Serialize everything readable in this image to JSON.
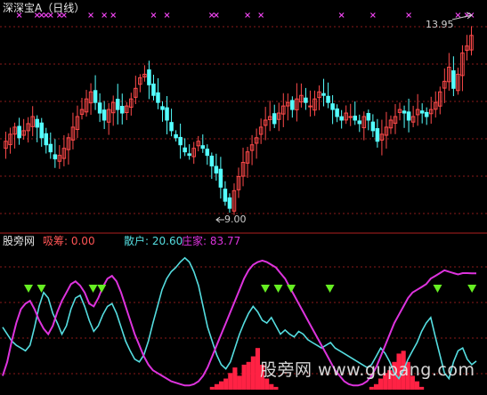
{
  "header": {
    "title": "深深宝A（日线）"
  },
  "indicator_header": {
    "name": "股旁网",
    "absorb": "吸筹: 0.00",
    "retail": "散户: 20.60",
    "dealer": "庄家: 83.77"
  },
  "annotations": {
    "high_price": "13.95",
    "low_price": "9.00"
  },
  "watermark": "股旁网 www.gupang.com",
  "colors": {
    "background": "#000000",
    "up_candle": "#ff4a4a",
    "down_candle": "#54ffff",
    "retail_line": "#55dde0",
    "dealer_line": "#dd33dd",
    "absorb_bars": "#ff2244",
    "signal_marker": "#66ee22",
    "top_markers": "#ee44ee",
    "grid": "#8a1a1a"
  },
  "chart_data": [
    {
      "type": "candlestick",
      "title": "深深宝A（日线）",
      "price_high": 13.95,
      "price_low": 9.0,
      "ylim": [
        8.6,
        14.5
      ],
      "close_series": [
        10.9,
        11.1,
        11.3,
        11.0,
        11.2,
        11.4,
        11.6,
        11.3,
        11.0,
        10.8,
        10.6,
        10.4,
        10.5,
        10.7,
        11.0,
        11.3,
        11.6,
        11.8,
        12.1,
        12.3,
        12.0,
        11.7,
        11.5,
        11.8,
        12.0,
        11.8,
        11.7,
        11.9,
        12.1,
        12.4,
        12.7,
        12.8,
        12.5,
        12.2,
        12.0,
        11.8,
        11.5,
        11.2,
        11.0,
        10.8,
        10.6,
        10.5,
        10.7,
        10.9,
        10.7,
        10.5,
        10.2,
        10.0,
        9.6,
        9.2,
        9.0,
        9.5,
        9.9,
        10.3,
        10.6,
        10.8,
        11.0,
        11.3,
        11.5,
        11.6,
        11.4,
        11.7,
        11.9,
        12.0,
        11.8,
        12.1,
        12.2,
        12.0,
        11.9,
        12.1,
        12.3,
        12.2,
        12.0,
        11.8,
        11.6,
        11.5,
        11.7,
        11.6,
        11.5,
        11.4,
        11.6,
        11.5,
        11.2,
        10.9,
        11.1,
        11.3,
        11.5,
        11.6,
        11.8,
        11.7,
        11.5,
        11.6,
        11.8,
        11.7,
        11.6,
        11.8,
        12.0,
        12.3,
        12.6,
        13.0,
        12.4,
        12.8,
        13.4,
        13.6,
        13.9
      ],
      "marker_type": "cross",
      "x_markers": [
        3,
        7,
        8,
        9,
        10,
        12,
        13,
        19,
        22,
        24,
        33,
        36,
        46,
        47,
        54,
        57,
        75,
        82,
        90,
        101,
        103,
        104
      ]
    },
    {
      "type": "line",
      "title": "股旁网",
      "ylim": [
        0,
        100
      ],
      "series": [
        {
          "name": "散户",
          "current": 20.6,
          "values": [
            45,
            40,
            35,
            32,
            30,
            28,
            32,
            45,
            60,
            70,
            66,
            55,
            48,
            40,
            46,
            58,
            66,
            68,
            60,
            50,
            42,
            46,
            54,
            60,
            62,
            55,
            45,
            35,
            28,
            22,
            20,
            25,
            35,
            48,
            60,
            72,
            80,
            85,
            88,
            92,
            95,
            92,
            85,
            75,
            60,
            45,
            35,
            25,
            18,
            15,
            20,
            30,
            40,
            48,
            55,
            60,
            56,
            50,
            48,
            52,
            46,
            40,
            43,
            40,
            38,
            42,
            40,
            36,
            34,
            32,
            30,
            32,
            34,
            30,
            28,
            26,
            24,
            22,
            20,
            18,
            16,
            18,
            24,
            30,
            26,
            20,
            12,
            8,
            14,
            22,
            28,
            34,
            42,
            48,
            52,
            38,
            25,
            12,
            8,
            20,
            28,
            30,
            22,
            18,
            20.6
          ]
        },
        {
          "name": "庄家",
          "current": 83.77,
          "values": [
            10,
            20,
            35,
            48,
            58,
            62,
            64,
            58,
            50,
            44,
            40,
            46,
            56,
            64,
            70,
            76,
            78,
            75,
            70,
            62,
            60,
            66,
            74,
            80,
            82,
            78,
            70,
            60,
            50,
            40,
            32,
            24,
            18,
            14,
            12,
            10,
            8,
            6,
            5,
            4,
            3,
            3,
            4,
            6,
            10,
            16,
            24,
            32,
            40,
            48,
            56,
            64,
            72,
            80,
            86,
            90,
            92,
            93,
            92,
            90,
            88,
            84,
            80,
            74,
            68,
            62,
            56,
            50,
            44,
            38,
            32,
            26,
            20,
            14,
            10,
            6,
            4,
            3,
            3,
            4,
            6,
            10,
            16,
            24,
            32,
            40,
            48,
            54,
            60,
            66,
            70,
            72,
            74,
            76,
            80,
            82,
            84,
            86,
            85,
            84,
            83,
            84,
            84,
            83.77,
            83.77
          ]
        },
        {
          "name": "吸筹",
          "type": "bar",
          "current": 0.0,
          "values": [
            0,
            0,
            0,
            0,
            0,
            0,
            0,
            0,
            0,
            0,
            0,
            0,
            0,
            0,
            0,
            0,
            0,
            0,
            0,
            0,
            0,
            0,
            0,
            0,
            0,
            0,
            0,
            0,
            0,
            0,
            0,
            0,
            0,
            0,
            0,
            0,
            0,
            0,
            0,
            0,
            0,
            0,
            0,
            0,
            0,
            0,
            2,
            4,
            6,
            8,
            12,
            16,
            10,
            18,
            20,
            24,
            30,
            18,
            8,
            4,
            2,
            0,
            0,
            0,
            0,
            0,
            0,
            0,
            0,
            0,
            0,
            0,
            0,
            0,
            0,
            0,
            0,
            0,
            0,
            0,
            0,
            2,
            4,
            8,
            12,
            14,
            20,
            26,
            28,
            20,
            10,
            6,
            2,
            0,
            0,
            0,
            0,
            0,
            0,
            0,
            0,
            0,
            0,
            0,
            0
          ]
        }
      ],
      "marker_type": "triangle-down",
      "signal_markers": [
        6,
        9,
        21,
        23,
        61,
        64,
        67,
        76,
        101,
        109
      ]
    }
  ]
}
